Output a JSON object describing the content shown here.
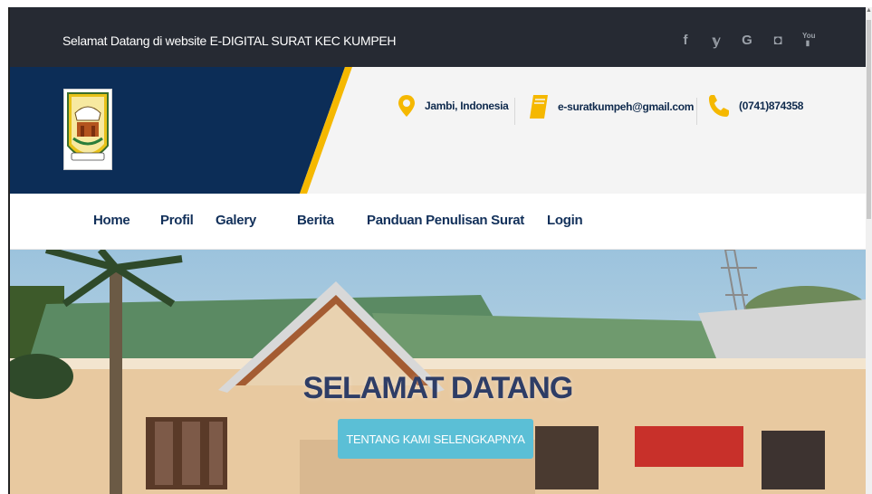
{
  "topbar": {
    "welcome": "Selamat Datang di website E-DIGITAL SURAT KEC KUMPEH",
    "social": [
      "f",
      "y",
      "G",
      "◘",
      "You"
    ]
  },
  "header": {
    "location": "Jambi, Indonesia",
    "email": "e-suratkumpeh@gmail.com",
    "phone": "(0741)874358"
  },
  "nav": {
    "items": [
      "Home",
      "Profil",
      "Galery",
      "Berita",
      "Panduan Penulisan Surat",
      "Login"
    ]
  },
  "hero": {
    "title": "SELAMAT DATANG",
    "button": "TENTANG KAMI SELENGKAPNYA"
  },
  "colors": {
    "topbar": "#262a33",
    "navy": "#0c2d57",
    "accent": "#f5b800",
    "button": "#5bbfd6"
  }
}
